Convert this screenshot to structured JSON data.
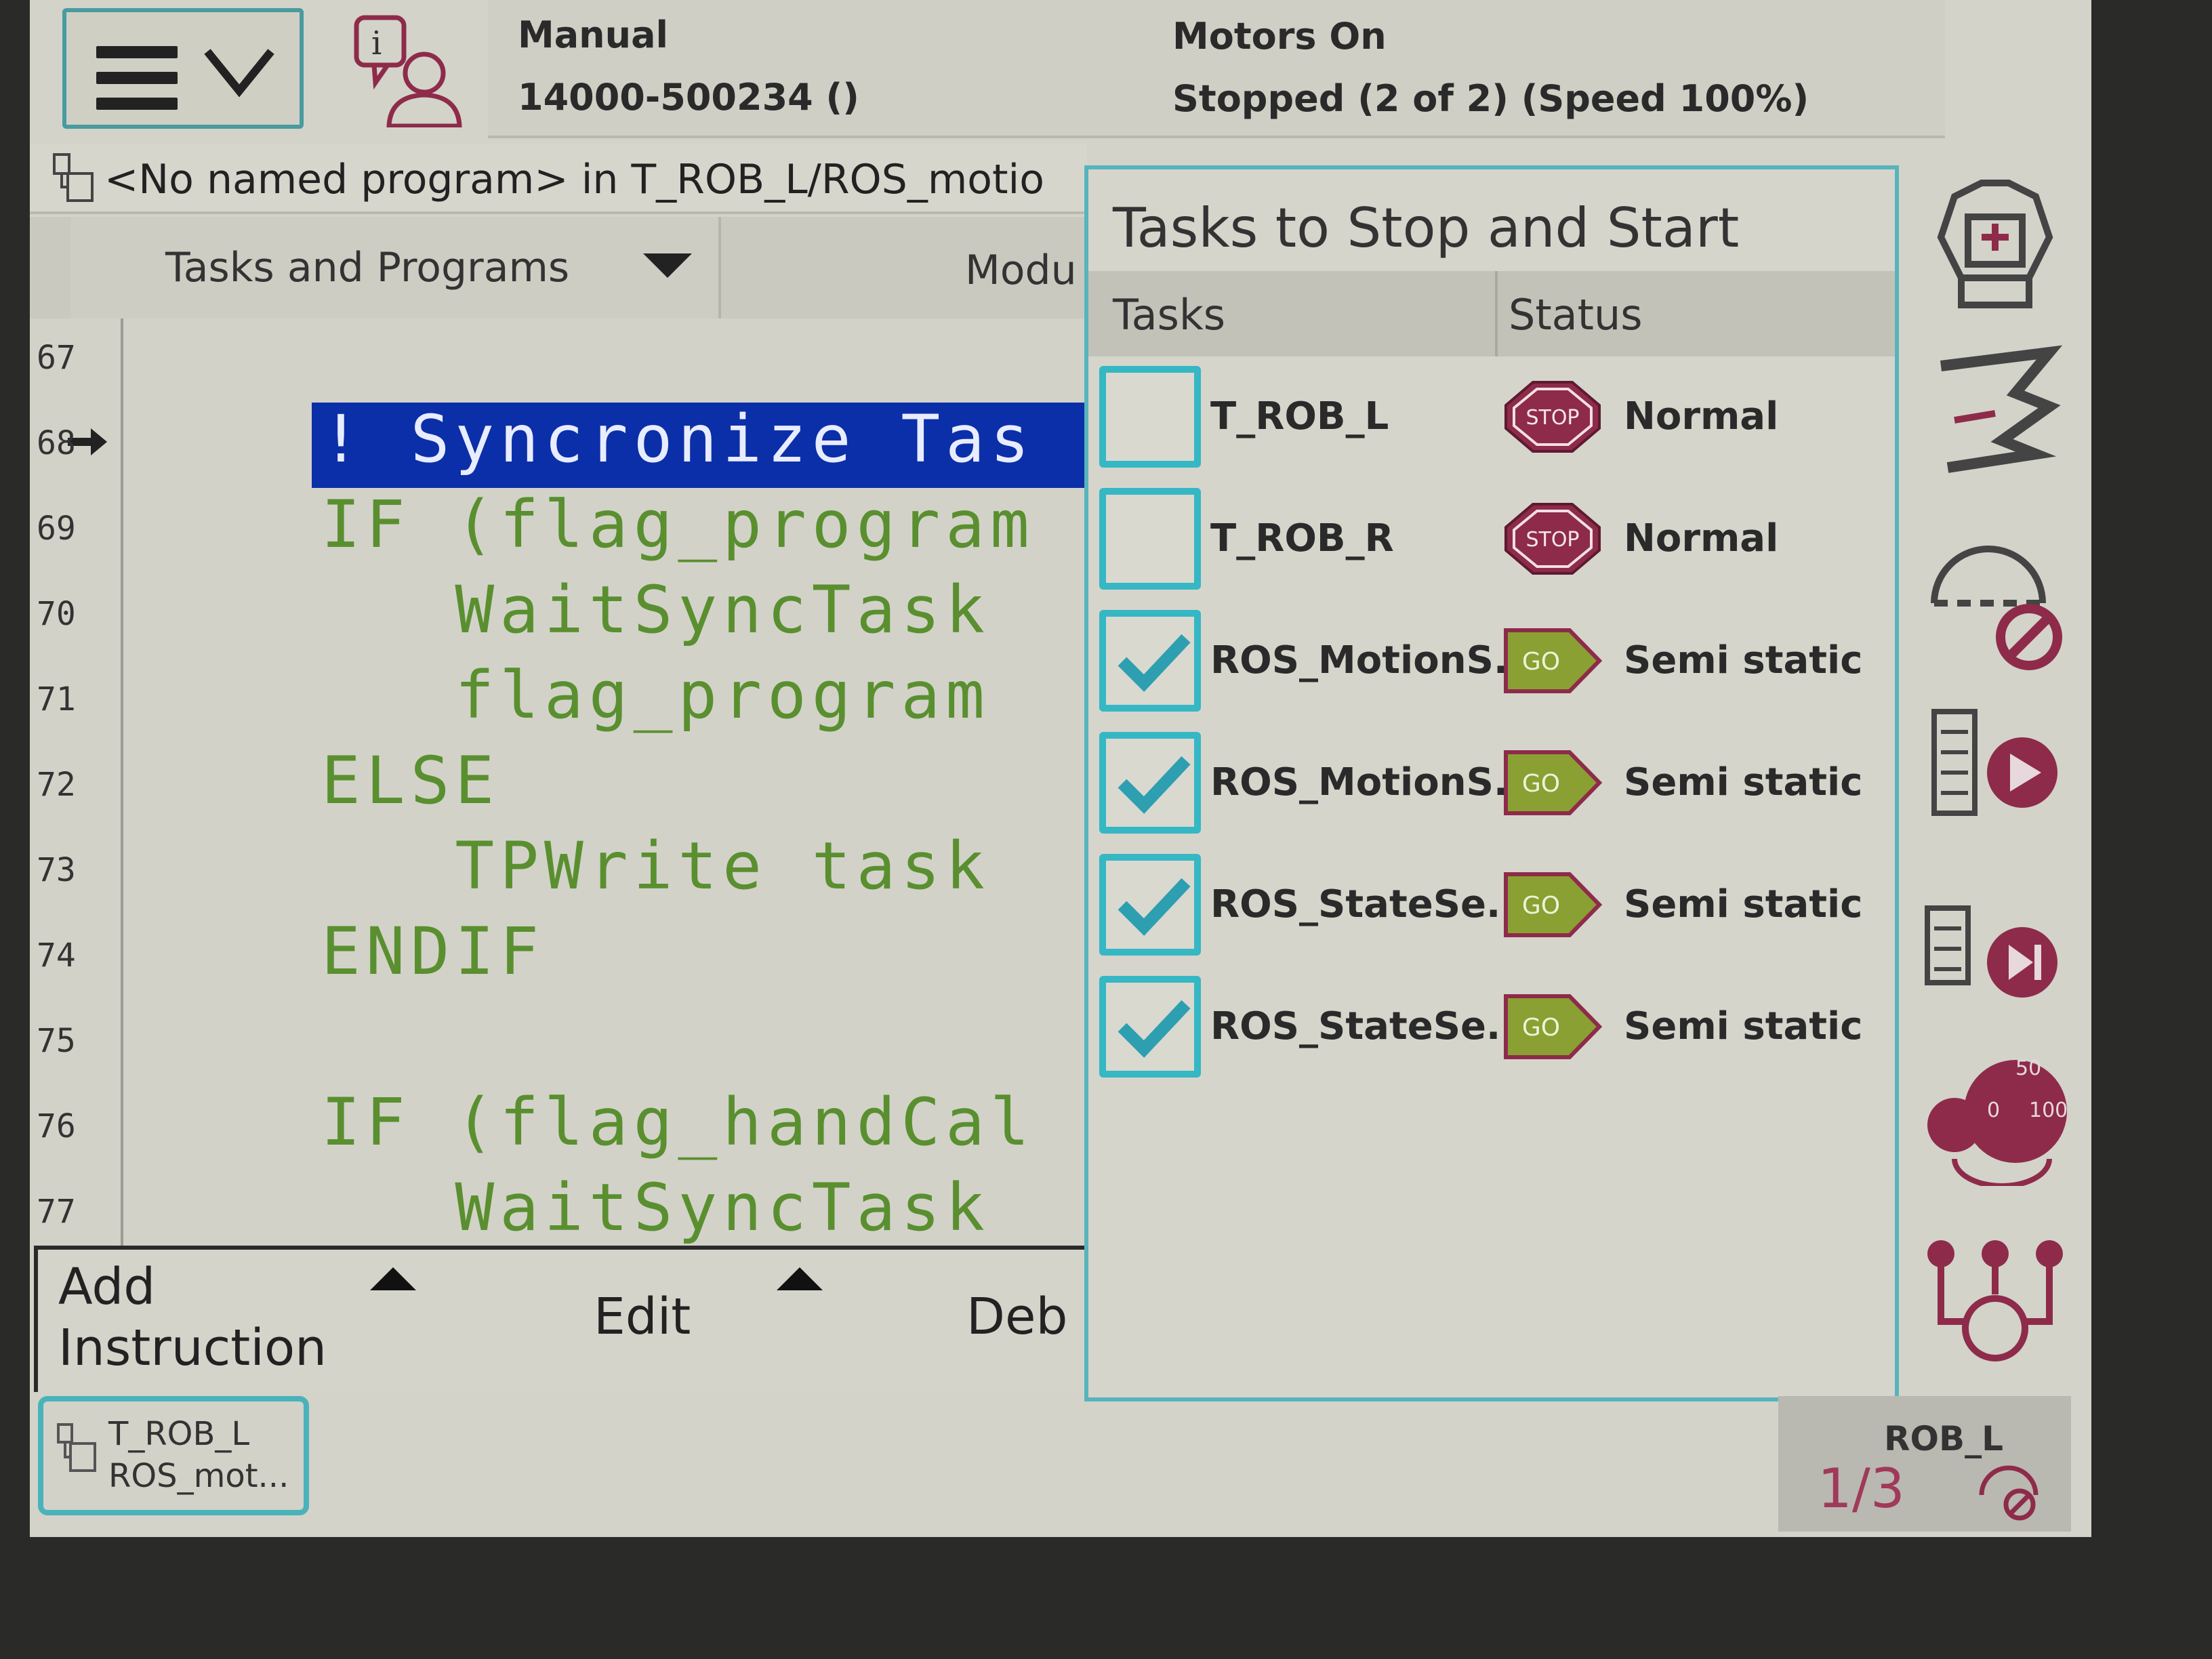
{
  "header": {
    "mode": "Manual",
    "controller_id": "14000-500234 ()",
    "motor_state": "Motors On",
    "run_state": "Stopped (2 of 2) (Speed 100%)"
  },
  "program_bar": {
    "text": "<No named program> in T_ROB_L/ROS_motio"
  },
  "tabs": {
    "tasks_programs": "Tasks and Programs",
    "modules": "Modu"
  },
  "editor": {
    "lines": [
      {
        "num": "67",
        "code": ""
      },
      {
        "num": "68",
        "code": "! Syncronize Tas"
      },
      {
        "num": "69",
        "code": "IF (flag_program"
      },
      {
        "num": "70",
        "code": "   WaitSyncTask"
      },
      {
        "num": "71",
        "code": "   flag_program"
      },
      {
        "num": "72",
        "code": "ELSE"
      },
      {
        "num": "73",
        "code": "   TPWrite task"
      },
      {
        "num": "74",
        "code": "ENDIF"
      },
      {
        "num": "75",
        "code": ""
      },
      {
        "num": "76",
        "code": "IF (flag_handCal"
      },
      {
        "num": "77",
        "code": "   WaitSyncTask"
      }
    ]
  },
  "bottom_toolbar": {
    "add_line1": "Add",
    "add_line2": "Instruction",
    "edit": "Edit",
    "debug": "Deb"
  },
  "popup": {
    "title": "Tasks to Stop and Start",
    "col_tasks": "Tasks",
    "col_status": "Status",
    "rows": [
      {
        "name": "T_ROB_L",
        "checked": false,
        "icon": "STOP",
        "status": "Normal"
      },
      {
        "name": "T_ROB_R",
        "checked": false,
        "icon": "STOP",
        "status": "Normal"
      },
      {
        "name": "ROS_MotionS...",
        "checked": true,
        "icon": "GO",
        "status": "Semi static"
      },
      {
        "name": "ROS_MotionS...",
        "checked": true,
        "icon": "GO",
        "status": "Semi static"
      },
      {
        "name": "ROS_StateSe...",
        "checked": true,
        "icon": "GO",
        "status": "Semi static"
      },
      {
        "name": "ROS_StateSe...",
        "checked": true,
        "icon": "GO",
        "status": "Semi static"
      }
    ]
  },
  "taskbar": {
    "task_line1": "T_ROB_L",
    "task_line2": "ROS_mot...",
    "quickset_unit": "ROB_L",
    "quickset_fraction": "1/3"
  },
  "speed_gauge": {
    "label_50": "50",
    "label_0": "0",
    "label_100": "100"
  },
  "colors": {
    "accent_teal": "#35b7c4",
    "icon_maroon": "#8e2b4a",
    "code_green": "#5a8f2f",
    "highlight_blue": "#0b2fa8",
    "go_green": "#8aa033"
  }
}
